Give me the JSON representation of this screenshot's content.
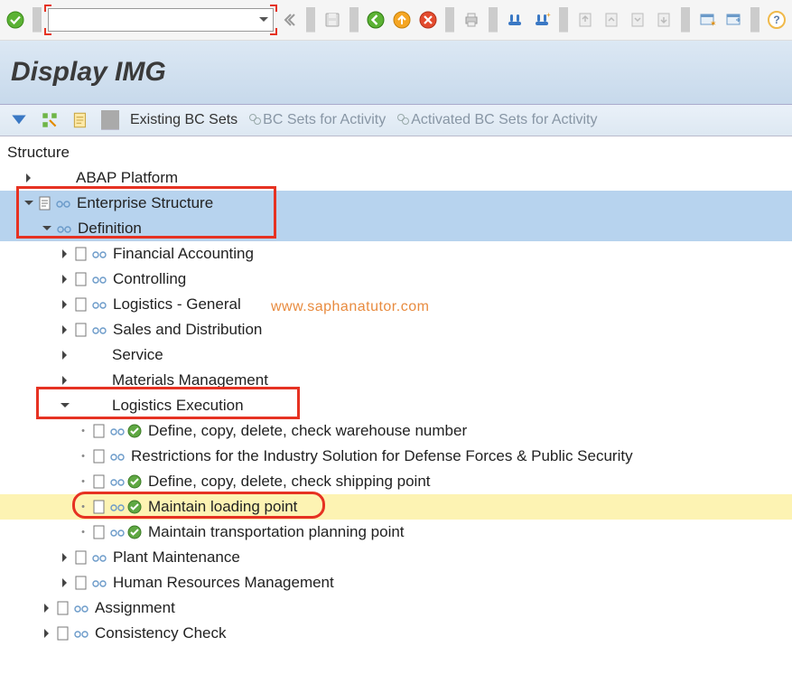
{
  "title": "Display IMG",
  "cmd_placeholder": "",
  "action_bar": {
    "existing_bc": "Existing BC Sets",
    "bc_for_activity": "BC Sets for Activity",
    "activated_bc": "Activated BC Sets for Activity"
  },
  "tree_header": "Structure",
  "watermark": "www.saphanatutor.com",
  "tree": {
    "abap": "ABAP Platform",
    "ent": "Enterprise Structure",
    "def": "Definition",
    "fin": "Financial Accounting",
    "ctrl": "Controlling",
    "log_gen": "Logistics - General",
    "sd": "Sales and Distribution",
    "service": "Service",
    "mm": "Materials Management",
    "le": "Logistics Execution",
    "le_wh": "Define, copy, delete, check warehouse number",
    "le_restrict": "Restrictions for the Industry Solution for Defense Forces & Public Security",
    "le_ship": "Define, copy, delete, check shipping point",
    "le_load": "Maintain loading point",
    "le_trans": "Maintain transportation planning point",
    "pm": "Plant Maintenance",
    "hr": "Human Resources Management",
    "assign": "Assignment",
    "cons": "Consistency Check"
  }
}
